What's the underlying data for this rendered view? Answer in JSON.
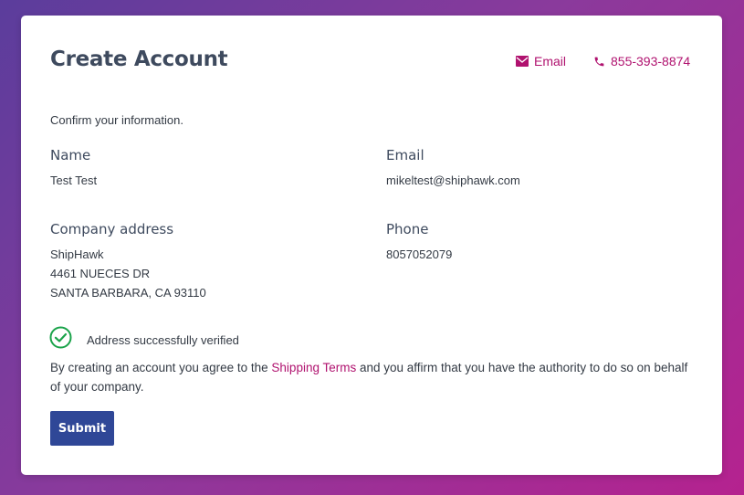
{
  "header": {
    "title": "Create Account",
    "email_link": "Email",
    "phone_link": "855-393-8874"
  },
  "intro": "Confirm your information.",
  "fields": {
    "name": {
      "label": "Name",
      "value": "Test Test"
    },
    "email": {
      "label": "Email",
      "value": "mikeltest@shiphawk.com"
    },
    "address": {
      "label": "Company address",
      "lines": [
        "ShipHawk",
        "4461 NUECES DR",
        "SANTA BARBARA, CA 93110"
      ]
    },
    "phone": {
      "label": "Phone",
      "value": "8057052079"
    }
  },
  "verification": {
    "text": "Address successfully verified",
    "status_color": "#1aa34a"
  },
  "terms": {
    "before": "By creating an account you agree to the ",
    "link": "Shipping Terms",
    "after": " and you affirm that you have the authority to do so on behalf of your company."
  },
  "submit_label": "Submit",
  "colors": {
    "accent": "#b0126f",
    "primary_button": "#2f4797",
    "heading": "#3e4a5e"
  },
  "icons": {
    "email": "envelope-icon",
    "phone": "phone-icon",
    "verified": "check-circle-icon"
  }
}
